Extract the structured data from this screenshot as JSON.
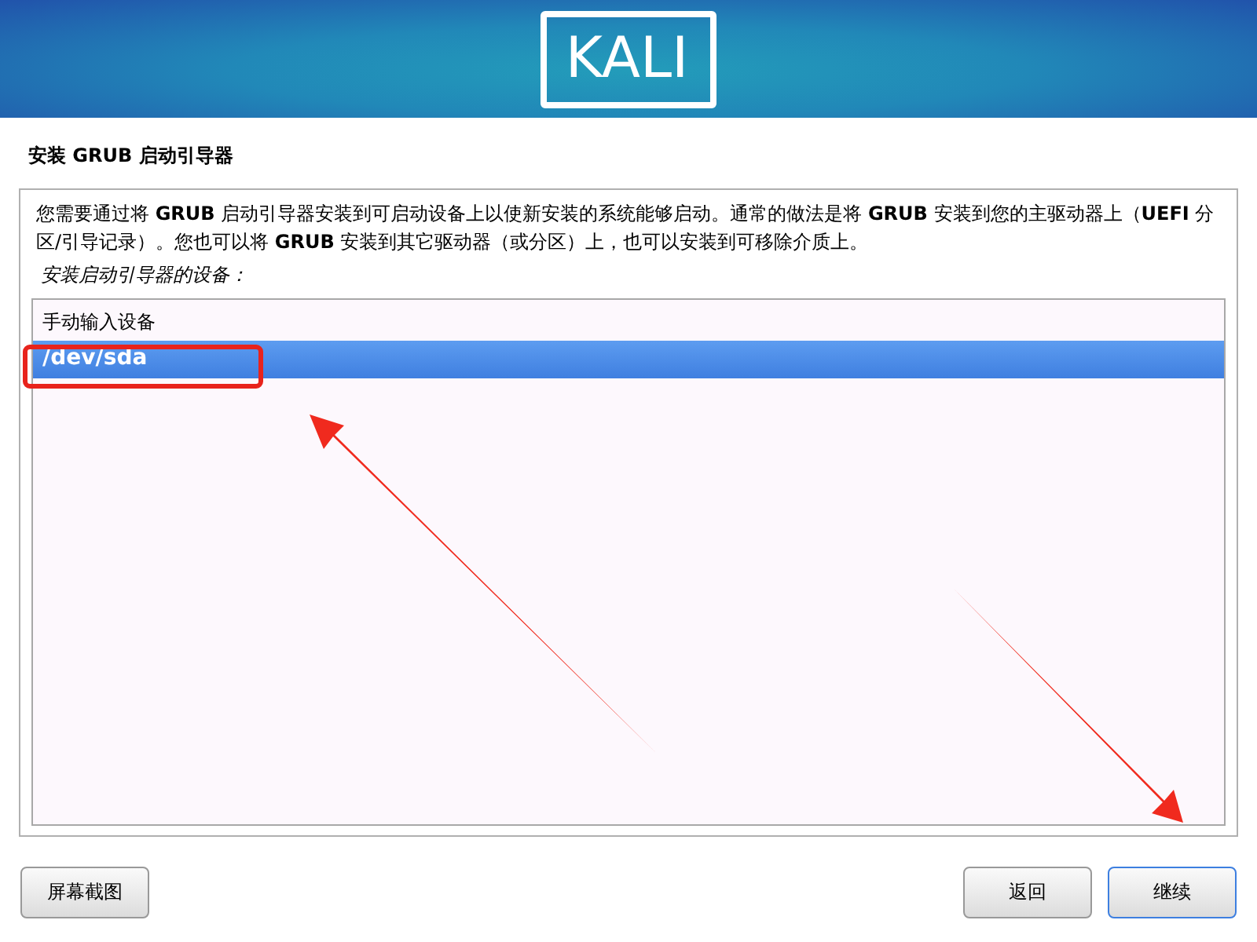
{
  "banner": {
    "logo": "KALI"
  },
  "title": "安装 GRUB 启动引导器",
  "description": "您需要通过将 **GRUB** 启动引导器安装到可启动设备上以使新安装的系统能够启动。通常的做法是将 **GRUB** 安装到您的主驱动器上（**UEFI** 分区/引导记录）。您也可以将 **GRUB** 安装到其它驱动器（或分区）上，也可以安装到可移除介质上。",
  "prompt": "安装启动引导器的设备：",
  "devices": [
    {
      "label": "手动输入设备",
      "selected": false
    },
    {
      "label": "/dev/sda",
      "selected": true
    }
  ],
  "buttons": [
    {
      "label": "屏幕截图",
      "kind": "left"
    },
    {
      "label": "返回",
      "kind": "right"
    },
    {
      "label": "继续",
      "kind": "default"
    }
  ]
}
